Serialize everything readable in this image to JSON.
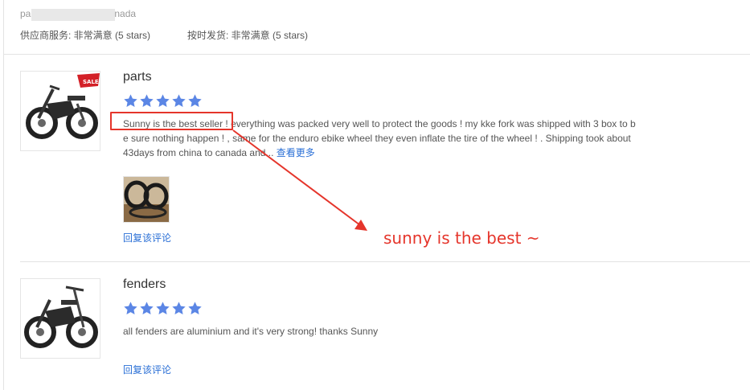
{
  "buyer": {
    "name_prefix": "pa",
    "name_suffix": "nada"
  },
  "ratings": {
    "supplier_service": "供应商服务: 非常满意 (5 stars)",
    "shipping": "按时发货: 非常满意 (5 stars)"
  },
  "reviews": [
    {
      "title": "parts",
      "stars": 5,
      "highlight": "Sunny is the best seller !",
      "line1": " everything was packed very well to protect the goods !  my kke fork was shipped with 3 box to b",
      "line2": "e sure nothing happen ! , same for the enduro ebike wheel  they even inflate the tire of the wheel ! .  Shipping took  about",
      "line3": "43days from china to canada   and...",
      "see_more": "查看更多",
      "reply": "回复该评论",
      "has_sale_badge": true,
      "sale_badge": "SALE"
    },
    {
      "title": "fenders",
      "stars": 5,
      "text": "all fenders are aluminium and it's very strong! thanks Sunny",
      "reply": "回复该评论"
    }
  ],
  "annotation": {
    "text": "sunny is the best ~",
    "color": "#e5352b"
  },
  "colors": {
    "star": "#5b86e5",
    "link": "#2a6fd6",
    "annotation": "#e5352b"
  }
}
